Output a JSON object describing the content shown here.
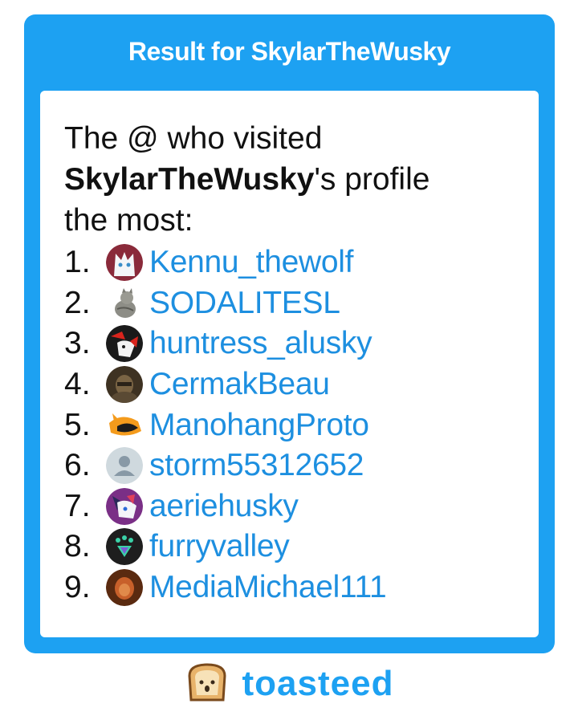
{
  "card": {
    "title": "Result for SkylarTheWusky"
  },
  "headline": {
    "prefix": "The @ who visited",
    "username": "SkylarTheWusky",
    "suffix_1": "'s profile",
    "suffix_2": "the most:"
  },
  "visitors": [
    {
      "rank": "1.",
      "handle": "Kennu_thewolf",
      "avatar": "white-wolf-avatar-icon"
    },
    {
      "rank": "2.",
      "handle": "SODALITESL",
      "avatar": "cat-avatar-icon"
    },
    {
      "rank": "3.",
      "handle": "huntress_alusky",
      "avatar": "red-black-fox-avatar-icon"
    },
    {
      "rank": "4.",
      "handle": "CermakBeau",
      "avatar": "brown-photo-avatar-icon"
    },
    {
      "rank": "5.",
      "handle": "ManohangProto",
      "avatar": "orange-protogen-avatar-icon"
    },
    {
      "rank": "6.",
      "handle": "storm55312652",
      "avatar": "default-user-avatar-icon"
    },
    {
      "rank": "7.",
      "handle": "aeriehusky",
      "avatar": "purple-husky-avatar-icon"
    },
    {
      "rank": "8.",
      "handle": "furryvalley",
      "avatar": "green-paw-avatar-icon"
    },
    {
      "rank": "9.",
      "handle": "MediaMichael111",
      "avatar": "orange-photo-avatar-icon"
    }
  ],
  "brand": {
    "name": "toasteed"
  },
  "colors": {
    "accent": "#1da1f2",
    "link": "#1d8fe0",
    "text": "#111111"
  }
}
